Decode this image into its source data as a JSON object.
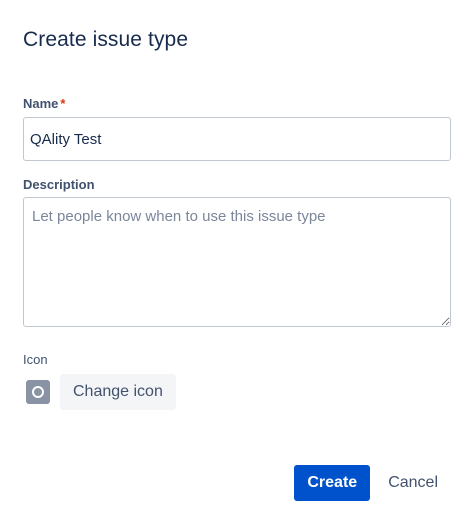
{
  "dialog": {
    "title": "Create issue type"
  },
  "form": {
    "name": {
      "label": "Name",
      "required_marker": "*",
      "value": "QAlity Test"
    },
    "description": {
      "label": "Description",
      "placeholder": "Let people know when to use this issue type"
    },
    "icon": {
      "label": "Icon",
      "icon_name": "circle-icon",
      "icon_bg": "#8993a4",
      "change_label": "Change icon"
    }
  },
  "footer": {
    "create_label": "Create",
    "cancel_label": "Cancel"
  },
  "colors": {
    "primary": "#0052cc",
    "required": "#de350b",
    "text": "#172b4d",
    "subtle_text": "#42526e",
    "border": "#c1c7d0"
  }
}
